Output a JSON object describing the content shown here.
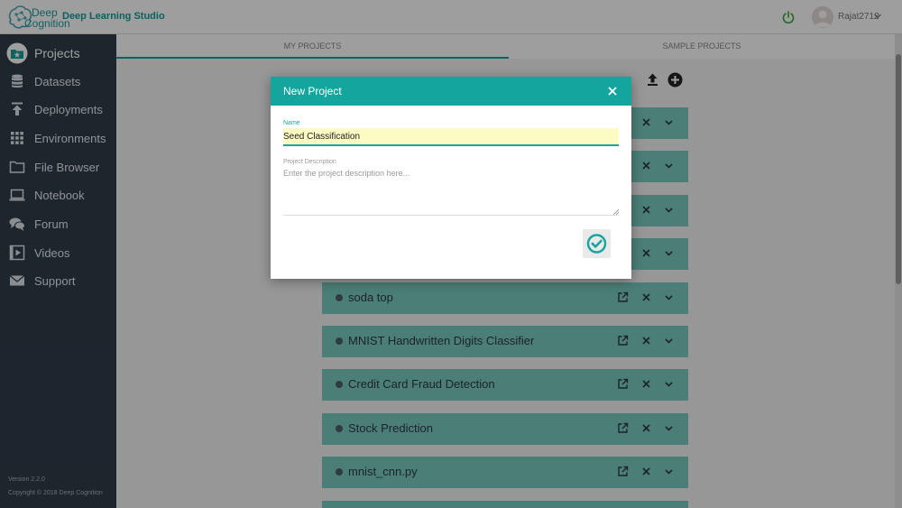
{
  "app": {
    "logo_word_top": "Deep",
    "logo_word_bottom": "Cognition",
    "title": "Deep Learning Studio",
    "username": "Rajat2712"
  },
  "sidebar": {
    "items": [
      {
        "label": "Projects",
        "icon": "folder-star-icon",
        "active": true
      },
      {
        "label": "Datasets",
        "icon": "database-icon"
      },
      {
        "label": "Deployments",
        "icon": "upload-icon"
      },
      {
        "label": "Environments",
        "icon": "grid-icon"
      },
      {
        "label": "File Browser",
        "icon": "folder-icon"
      },
      {
        "label": "Notebook",
        "icon": "laptop-icon"
      },
      {
        "label": "Forum",
        "icon": "chat-icon"
      },
      {
        "label": "Videos",
        "icon": "video-icon"
      },
      {
        "label": "Support",
        "icon": "mail-icon"
      }
    ],
    "version": "Version 2.2.0",
    "copyright": "Copyright © 2018 Deep Cognition"
  },
  "tabs": [
    {
      "label": "MY PROJECTS",
      "active": true
    },
    {
      "label": "SAMPLE PROJECTS",
      "active": false
    }
  ],
  "projects": [
    {
      "name": ""
    },
    {
      "name": ""
    },
    {
      "name": ""
    },
    {
      "name": ""
    },
    {
      "name": "soda top"
    },
    {
      "name": "MNIST Handwritten Digits Classifier"
    },
    {
      "name": "Credit Card Fraud Detection"
    },
    {
      "name": "Stock Prediction"
    },
    {
      "name": "mnist_cnn.py"
    }
  ],
  "modal": {
    "title": "New Project",
    "name_label": "Name",
    "name_value": "Seed Classification",
    "description_label": "Project Description",
    "description_placeholder": "Enter the project description here..."
  },
  "colors": {
    "accent": "#14a59e",
    "sidebar_bg": "#2f3e4a",
    "row_bg": "#79cbc1",
    "input_highlight": "#fcfbc4"
  }
}
